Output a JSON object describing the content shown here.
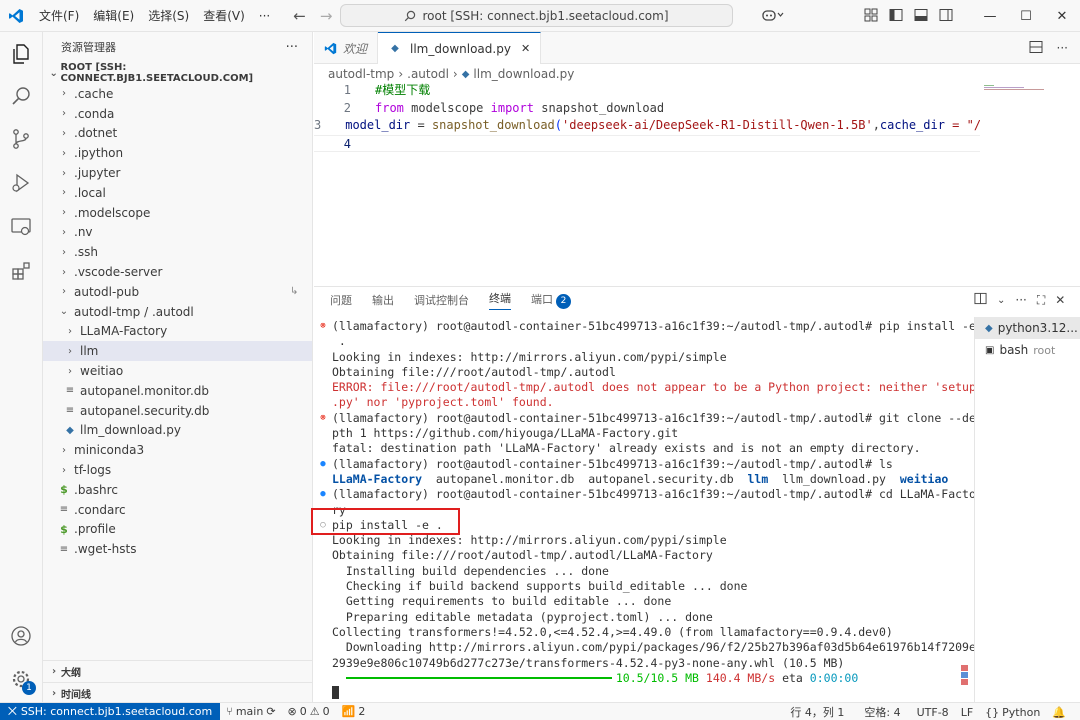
{
  "titlebar": {
    "menu": [
      "文件(F)",
      "编辑(E)",
      "选择(S)",
      "查看(V)",
      "···"
    ],
    "search": "root [SSH: connect.bjb1.seetacloud.com]"
  },
  "sidebar": {
    "header": "资源管理器",
    "root_label": "ROOT [SSH: CONNECT.BJB1.SEETACLOUD.COM]",
    "items": [
      {
        "label": ".cache",
        "depth": 1,
        "kind": "folder"
      },
      {
        "label": ".conda",
        "depth": 1,
        "kind": "folder"
      },
      {
        "label": ".dotnet",
        "depth": 1,
        "kind": "folder"
      },
      {
        "label": ".ipython",
        "depth": 1,
        "kind": "folder"
      },
      {
        "label": ".jupyter",
        "depth": 1,
        "kind": "folder"
      },
      {
        "label": ".local",
        "depth": 1,
        "kind": "folder"
      },
      {
        "label": ".modelscope",
        "depth": 1,
        "kind": "folder"
      },
      {
        "label": ".nv",
        "depth": 1,
        "kind": "folder"
      },
      {
        "label": ".ssh",
        "depth": 1,
        "kind": "folder"
      },
      {
        "label": ".vscode-server",
        "depth": 1,
        "kind": "folder"
      },
      {
        "label": "autodl-pub",
        "depth": 1,
        "kind": "folder"
      },
      {
        "label": "autodl-tmp / .autodl",
        "depth": 1,
        "kind": "folder-open"
      },
      {
        "label": "LLaMA-Factory",
        "depth": 2,
        "kind": "folder"
      },
      {
        "label": "llm",
        "depth": 2,
        "kind": "folder",
        "selected": true
      },
      {
        "label": "weitiao",
        "depth": 2,
        "kind": "folder"
      },
      {
        "label": "autopanel.monitor.db",
        "depth": 2,
        "kind": "file"
      },
      {
        "label": "autopanel.security.db",
        "depth": 2,
        "kind": "file"
      },
      {
        "label": "llm_download.py",
        "depth": 2,
        "kind": "python"
      },
      {
        "label": "miniconda3",
        "depth": 1,
        "kind": "folder"
      },
      {
        "label": "tf-logs",
        "depth": 1,
        "kind": "folder"
      },
      {
        "label": ".bashrc",
        "depth": 1,
        "kind": "shell"
      },
      {
        "label": ".condarc",
        "depth": 1,
        "kind": "file"
      },
      {
        "label": ".profile",
        "depth": 1,
        "kind": "shell"
      },
      {
        "label": ".wget-hsts",
        "depth": 1,
        "kind": "file"
      }
    ],
    "outline_label": "大纲",
    "timeline_label": "时间线",
    "accounts_badge": "1"
  },
  "editor": {
    "tabs": [
      {
        "label": "欢迎",
        "active": false
      },
      {
        "label": "llm_download.py",
        "active": true
      }
    ],
    "breadcrumb": [
      "autodl-tmp",
      ".autodl",
      "llm_download.py"
    ],
    "line_numbers": [
      "1",
      "2",
      "3",
      "4"
    ],
    "code": {
      "line1_comment": "#模型下载",
      "line2_kw_from": "from",
      "line2_module": "modelscope",
      "line2_kw_import": "import",
      "line2_name": "snapshot_download",
      "line3_var": "model_dir",
      "line3_eq": " = ",
      "line3_fn": "snapshot_download",
      "line3_paren": "(",
      "line3_str": "'deepseek-ai/DeepSeek-R1-Distill-Qwen-1.5B'",
      "line3_comma": ",",
      "line3_param": "cache_dir",
      "line3_tail": " = \"/"
    }
  },
  "panel": {
    "tabs": [
      "问题",
      "输出",
      "调试控制台",
      "终端",
      "端口"
    ],
    "active_tab": "终端",
    "ports_count": "2",
    "terminal_lines": [
      {
        "deco": "err",
        "text": "(llamafactory) root@autodl-container-51bc499713-a16c1f39:~/autodl-tmp/.autodl# pip install -e"
      },
      {
        "deco": "",
        "text": " ."
      },
      {
        "deco": "",
        "text": "Looking in indexes: http://mirrors.aliyun.com/pypi/simple"
      },
      {
        "deco": "",
        "text": "Obtaining file:///root/autodl-tmp/.autodl"
      },
      {
        "deco": "",
        "style": "error",
        "text": "ERROR: file:///root/autodl-tmp/.autodl does not appear to be a Python project: neither 'setup"
      },
      {
        "deco": "",
        "style": "error",
        "text": ".py' nor 'pyproject.toml' found."
      },
      {
        "deco": "err",
        "text": "(llamafactory) root@autodl-container-51bc499713-a16c1f39:~/autodl-tmp/.autodl# git clone --de"
      },
      {
        "deco": "",
        "text": "pth 1 https://github.com/hiyouga/LLaMA-Factory.git"
      },
      {
        "deco": "",
        "text": "fatal: destination path 'LLaMA-Factory' already exists and is not an empty directory."
      },
      {
        "deco": "ok",
        "text": "(llamafactory) root@autodl-container-51bc499713-a16c1f39:~/autodl-tmp/.autodl# ls"
      },
      {
        "deco": "",
        "style": "ls",
        "text": ""
      },
      {
        "deco": "ok",
        "text": "(llamafactory) root@autodl-container-51bc499713-a16c1f39:~/autodl-tmp/.autodl# cd LLaMA-Facto"
      },
      {
        "deco": "",
        "text": "ry"
      },
      {
        "deco": "run",
        "text": "pip install -e ."
      },
      {
        "deco": "",
        "text": "Looking in indexes: http://mirrors.aliyun.com/pypi/simple"
      },
      {
        "deco": "",
        "text": "Obtaining file:///root/autodl-tmp/.autodl/LLaMA-Factory"
      },
      {
        "deco": "",
        "text": "  Installing build dependencies ... done"
      },
      {
        "deco": "",
        "text": "  Checking if build backend supports build_editable ... done"
      },
      {
        "deco": "",
        "text": "  Getting requirements to build editable ... done"
      },
      {
        "deco": "",
        "text": "  Preparing editable metadata (pyproject.toml) ... done"
      },
      {
        "deco": "",
        "text": "Collecting transformers!=4.52.0,<=4.52.4,>=4.49.0 (from llamafactory==0.9.4.dev0)"
      },
      {
        "deco": "",
        "text": "  Downloading http://mirrors.aliyun.com/pypi/packages/96/f2/25b27b396af03d5b64e61976b14f7209e"
      },
      {
        "deco": "",
        "text": "2939e9e806c10749b6d277c273e/transformers-4.52.4-py3-none-any.whl (10.5 MB)"
      }
    ],
    "ls_output": {
      "dir1": "LLaMA-Factory",
      "file1": "autopanel.monitor.db",
      "file2": "autopanel.security.db",
      "dir2": "llm",
      "file3": "llm_download.py",
      "dir3": "weitiao"
    },
    "download": {
      "fraction": 1.0,
      "size": "10.5/10.5 MB",
      "speed": "140.4 MB/s",
      "eta_label": "eta",
      "eta": "0:00:00"
    },
    "terminals": [
      {
        "name": "python3.12...",
        "active": true
      },
      {
        "name": "bash",
        "sub": "root",
        "active": false
      }
    ]
  },
  "statusbar": {
    "remote": "SSH: connect.bjb1.seetacloud.com",
    "branch": "main",
    "errors": "0",
    "warnings": "0",
    "ports": "2",
    "position": "行 4，列 1",
    "spaces": "空格: 4",
    "encoding": "UTF-8",
    "eol": "LF",
    "language": "Python"
  },
  "colors": {
    "accent": "#005fb8",
    "highlight_box": "#e01e1e"
  }
}
